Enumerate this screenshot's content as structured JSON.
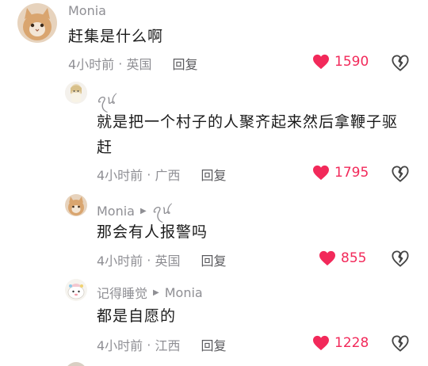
{
  "colors": {
    "like": "#f2295a",
    "meta": "#8f8f94",
    "text": "#1a1a1a"
  },
  "comments": [
    {
      "user": "Monia",
      "reply_to": "",
      "text": "赶集是什么啊",
      "text2": "",
      "time": "4小时前",
      "location": "英国",
      "reply": "回复",
      "likes": "1590"
    },
    {
      "user": "ꪖꪙ",
      "reply_to": "",
      "text": "就是把一个村子的人聚齐起来然后拿鞭子驱",
      "text2": "赶",
      "time": "4小时前",
      "location": "广西",
      "reply": "回复",
      "likes": "1795"
    },
    {
      "user": "Monia",
      "reply_to": "ꪖꪙ",
      "text": "那会有人报警吗",
      "text2": "",
      "time": "4小时前",
      "location": "英国",
      "reply": "回复",
      "likes": "855"
    },
    {
      "user": "记得睡觉",
      "reply_to": "Monia",
      "text": "都是自愿的",
      "text2": "",
      "time": "4小时前",
      "location": "江西",
      "reply": "回复",
      "likes": "1228"
    }
  ]
}
